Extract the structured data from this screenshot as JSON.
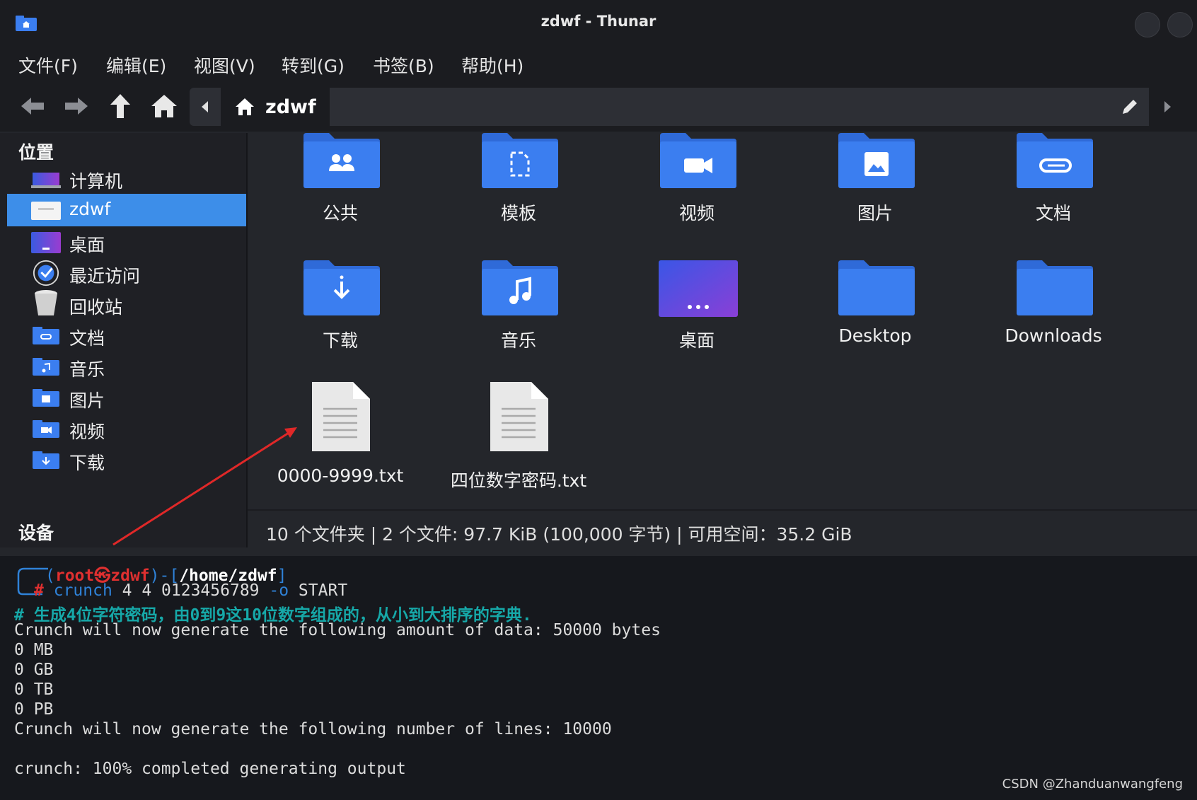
{
  "window": {
    "title": "zdwf - Thunar"
  },
  "menu": [
    "文件(F)",
    "编辑(E)",
    "视图(V)",
    "转到(G)",
    "书签(B)",
    "帮助(H)"
  ],
  "toolbar": {
    "breadcrumb": "zdwf"
  },
  "sidebar": {
    "places_header": "位置",
    "devices_header": "设备",
    "items": [
      {
        "label": "计算机",
        "icon": "computer-icon"
      },
      {
        "label": "zdwf",
        "icon": "home-folder-icon",
        "selected": true
      },
      {
        "label": "桌面",
        "icon": "desktop-icon"
      },
      {
        "label": "最近访问",
        "icon": "recent-icon"
      },
      {
        "label": "回收站",
        "icon": "trash-icon"
      },
      {
        "label": "文档",
        "icon": "documents-folder-icon"
      },
      {
        "label": "音乐",
        "icon": "music-folder-icon"
      },
      {
        "label": "图片",
        "icon": "pictures-folder-icon"
      },
      {
        "label": "视频",
        "icon": "videos-folder-icon"
      },
      {
        "label": "下载",
        "icon": "downloads-folder-icon"
      }
    ]
  },
  "files": [
    {
      "name": "公共",
      "icon": "public-folder-icon"
    },
    {
      "name": "模板",
      "icon": "templates-folder-icon"
    },
    {
      "name": "视频",
      "icon": "videos-folder-icon"
    },
    {
      "name": "图片",
      "icon": "pictures-folder-icon"
    },
    {
      "name": "文档",
      "icon": "documents-folder-icon"
    },
    {
      "name": "下载",
      "icon": "downloads-folder-icon"
    },
    {
      "name": "音乐",
      "icon": "music-folder-icon"
    },
    {
      "name": "桌面",
      "icon": "desktop-icon"
    },
    {
      "name": "Desktop",
      "icon": "folder-icon"
    },
    {
      "name": "Downloads",
      "icon": "folder-icon"
    },
    {
      "name": "0000-9999.txt",
      "icon": "text-file-icon"
    },
    {
      "name": "四位数字密码.txt",
      "icon": "text-file-icon"
    }
  ],
  "status": {
    "text": "10 个文件夹 | 2 个文件: 97.7 KiB (100,000 字节) | 可用空间：35.2 GiB"
  },
  "terminal": {
    "prompt_user": "root㉿zdwf",
    "prompt_path": "/home/zdwf",
    "command": "crunch",
    "command_args": " 4 4 0123456789 ",
    "command_flag": "-o",
    "command_target": " START",
    "comment": "# 生成4位字符密码，由0到9这10位数字组成的，从小到大排序的字典.",
    "lines": [
      "Crunch will now generate the following amount of data: 50000 bytes",
      "0 MB",
      "0 GB",
      "0 TB",
      "0 PB",
      "Crunch will now generate the following number of lines: 10000",
      "",
      "crunch: 100% completed generating output"
    ]
  },
  "watermark": "CSDN @Zhanduanwangfeng",
  "colors": {
    "folder": "#3b7ef0",
    "selection": "#3d8ee9",
    "arrow": "#e02828"
  }
}
